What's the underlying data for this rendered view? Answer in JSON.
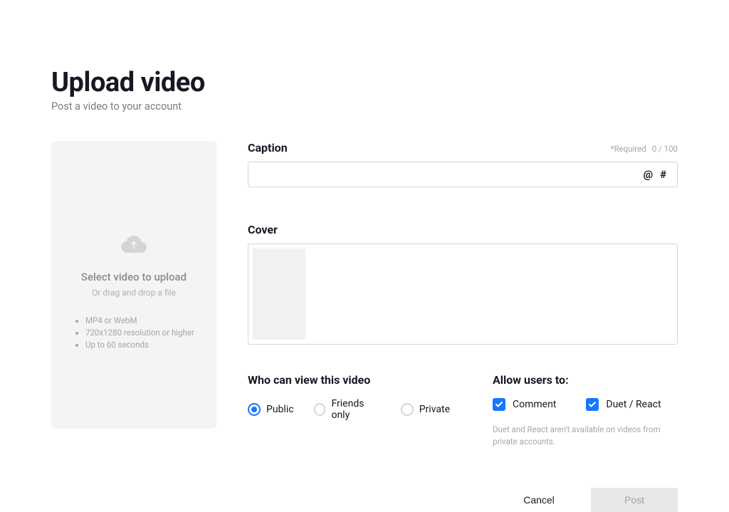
{
  "page": {
    "title": "Upload video",
    "subtitle": "Post a video to your account"
  },
  "dropzone": {
    "title": "Select video to upload",
    "subtitle": "Or drag and drop a file",
    "specs": [
      "MP4 or WebM",
      "720x1280 resolution or higher",
      "Up to 60 seconds"
    ]
  },
  "caption": {
    "label": "Caption",
    "required_text": "*Required",
    "counter": "0 / 100",
    "value": "",
    "mention_symbol": "@",
    "hashtag_symbol": "#"
  },
  "cover": {
    "label": "Cover"
  },
  "privacy": {
    "label": "Who can view this video",
    "options": [
      {
        "label": "Public",
        "selected": true
      },
      {
        "label": "Friends only",
        "selected": false
      },
      {
        "label": "Private",
        "selected": false
      }
    ]
  },
  "allow": {
    "label": "Allow users to:",
    "options": [
      {
        "label": "Comment",
        "checked": true
      },
      {
        "label": "Duet / React",
        "checked": true
      }
    ],
    "note": "Duet and React aren't available on videos from private accounts."
  },
  "actions": {
    "cancel": "Cancel",
    "post": "Post"
  }
}
